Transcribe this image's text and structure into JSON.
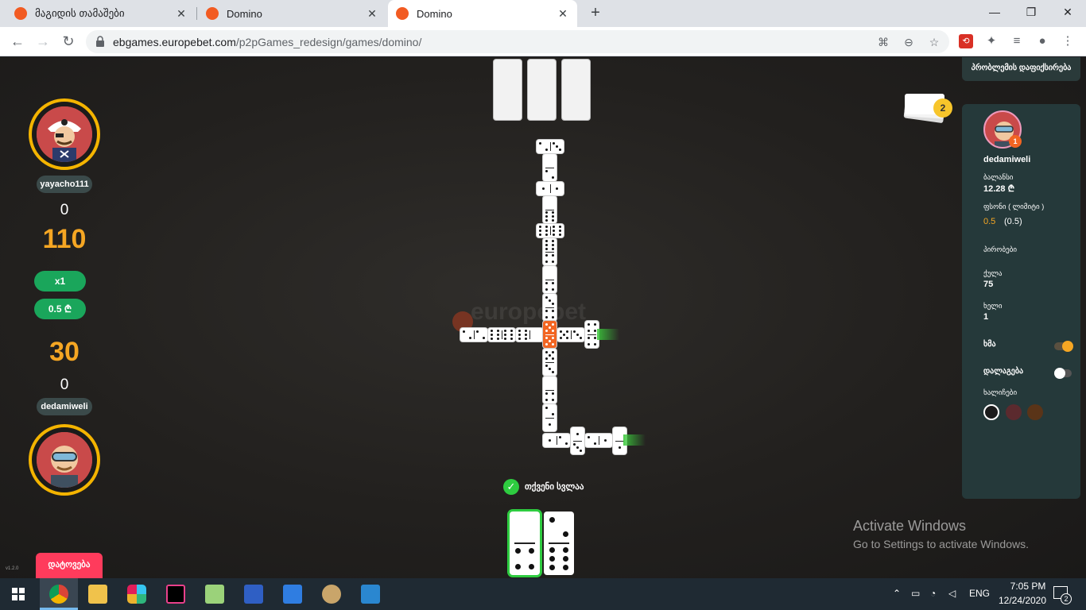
{
  "browser": {
    "tabs": [
      {
        "title": "მაგიდის თამაშები"
      },
      {
        "title": "Domino"
      },
      {
        "title": "Domino"
      }
    ],
    "url_host": "ebgames.europebet.com",
    "url_path": "/p2pGames_redesign/games/domino/"
  },
  "game": {
    "opponent": {
      "name": "yayacho111",
      "points": "0",
      "score": "110"
    },
    "multiplier": "x1",
    "stake": "0.5 ₾",
    "me": {
      "score": "30",
      "points": "0",
      "name": "dedamiweli"
    },
    "leave_label": "დატოვება",
    "version": "v1.2.0",
    "turn_text": "თქვენი სვლაა",
    "deck_count": "2",
    "watermark": "europebet"
  },
  "panel": {
    "rules_label": "პრობლემის დაფიქსირება",
    "player_name": "dedamiweli",
    "player_level": "1",
    "balance_label": "ბალანსი",
    "balance_value": "12.28 ₾",
    "fee_label": "ფსონი ( ლიმიტი )",
    "fee_value": "0.5",
    "fee_limit": "(0.5)",
    "conditions_label": "პირობები",
    "points_label": "ქულა",
    "points_value": "75",
    "hand_label": "ხელი",
    "hand_value": "1",
    "sound_label": "ხმა",
    "help_label": "დალაგება",
    "colors_label": "ხალიჩები",
    "swatches": [
      "#1b1b1b",
      "#5b2a2e",
      "#5a3418"
    ],
    "accent": "#f5a623"
  },
  "windows": {
    "activate_title": "Activate Windows",
    "activate_sub": "Go to Settings to activate Windows.",
    "lang": "ENG",
    "time": "7:05 PM",
    "date": "12/24/2020",
    "notif": "2"
  }
}
